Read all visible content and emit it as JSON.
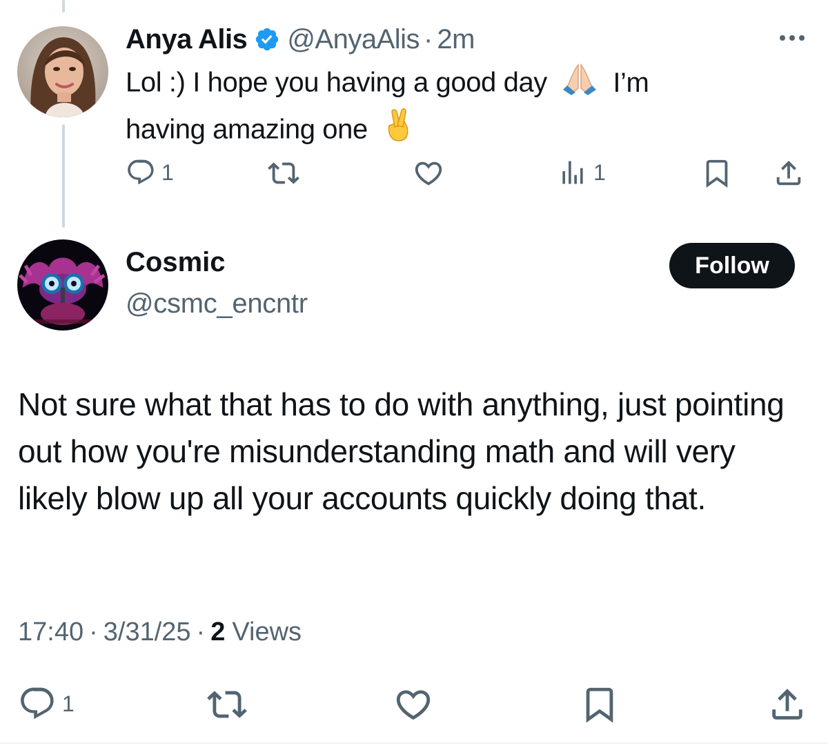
{
  "parent_tweet": {
    "author_name": "Anya Alis",
    "verified": true,
    "handle": "@AnyaAlis",
    "separator": "·",
    "time": "2m",
    "text_line1": "Lol :) I hope you having a good day",
    "text_line1_end": "I’m",
    "text_line2": "having amazing one",
    "emojis": [
      "folded-hands-emoji",
      "crossed-fingers-emoji"
    ],
    "actions": {
      "reply_count": "1",
      "retweet_count": "",
      "like_count": "",
      "views_count": "1"
    },
    "icons": [
      "more-icon",
      "reply-icon",
      "retweet-icon",
      "like-icon",
      "views-icon",
      "bookmark-icon",
      "share-icon"
    ]
  },
  "main_tweet": {
    "author_name": "Cosmic",
    "handle": "@csmc_encntr",
    "follow_label": "Follow",
    "text": "Not sure what that has to do with anything, just pointing out how you're misunderstanding math and will very likely blow up all your accounts quickly doing that.",
    "time": "17:40",
    "date": "3/31/25",
    "separator": "·",
    "views_count": "2",
    "views_label": "Views",
    "actions": {
      "reply_count": "1"
    },
    "icons": [
      "reply-icon",
      "retweet-icon",
      "like-icon",
      "bookmark-icon",
      "share-icon"
    ]
  },
  "colors": {
    "text": "#0f1419",
    "secondary": "#536471",
    "verified_blue": "#1d9bf0",
    "thread_line": "#cfd9de",
    "follow_bg": "#0f1419"
  }
}
